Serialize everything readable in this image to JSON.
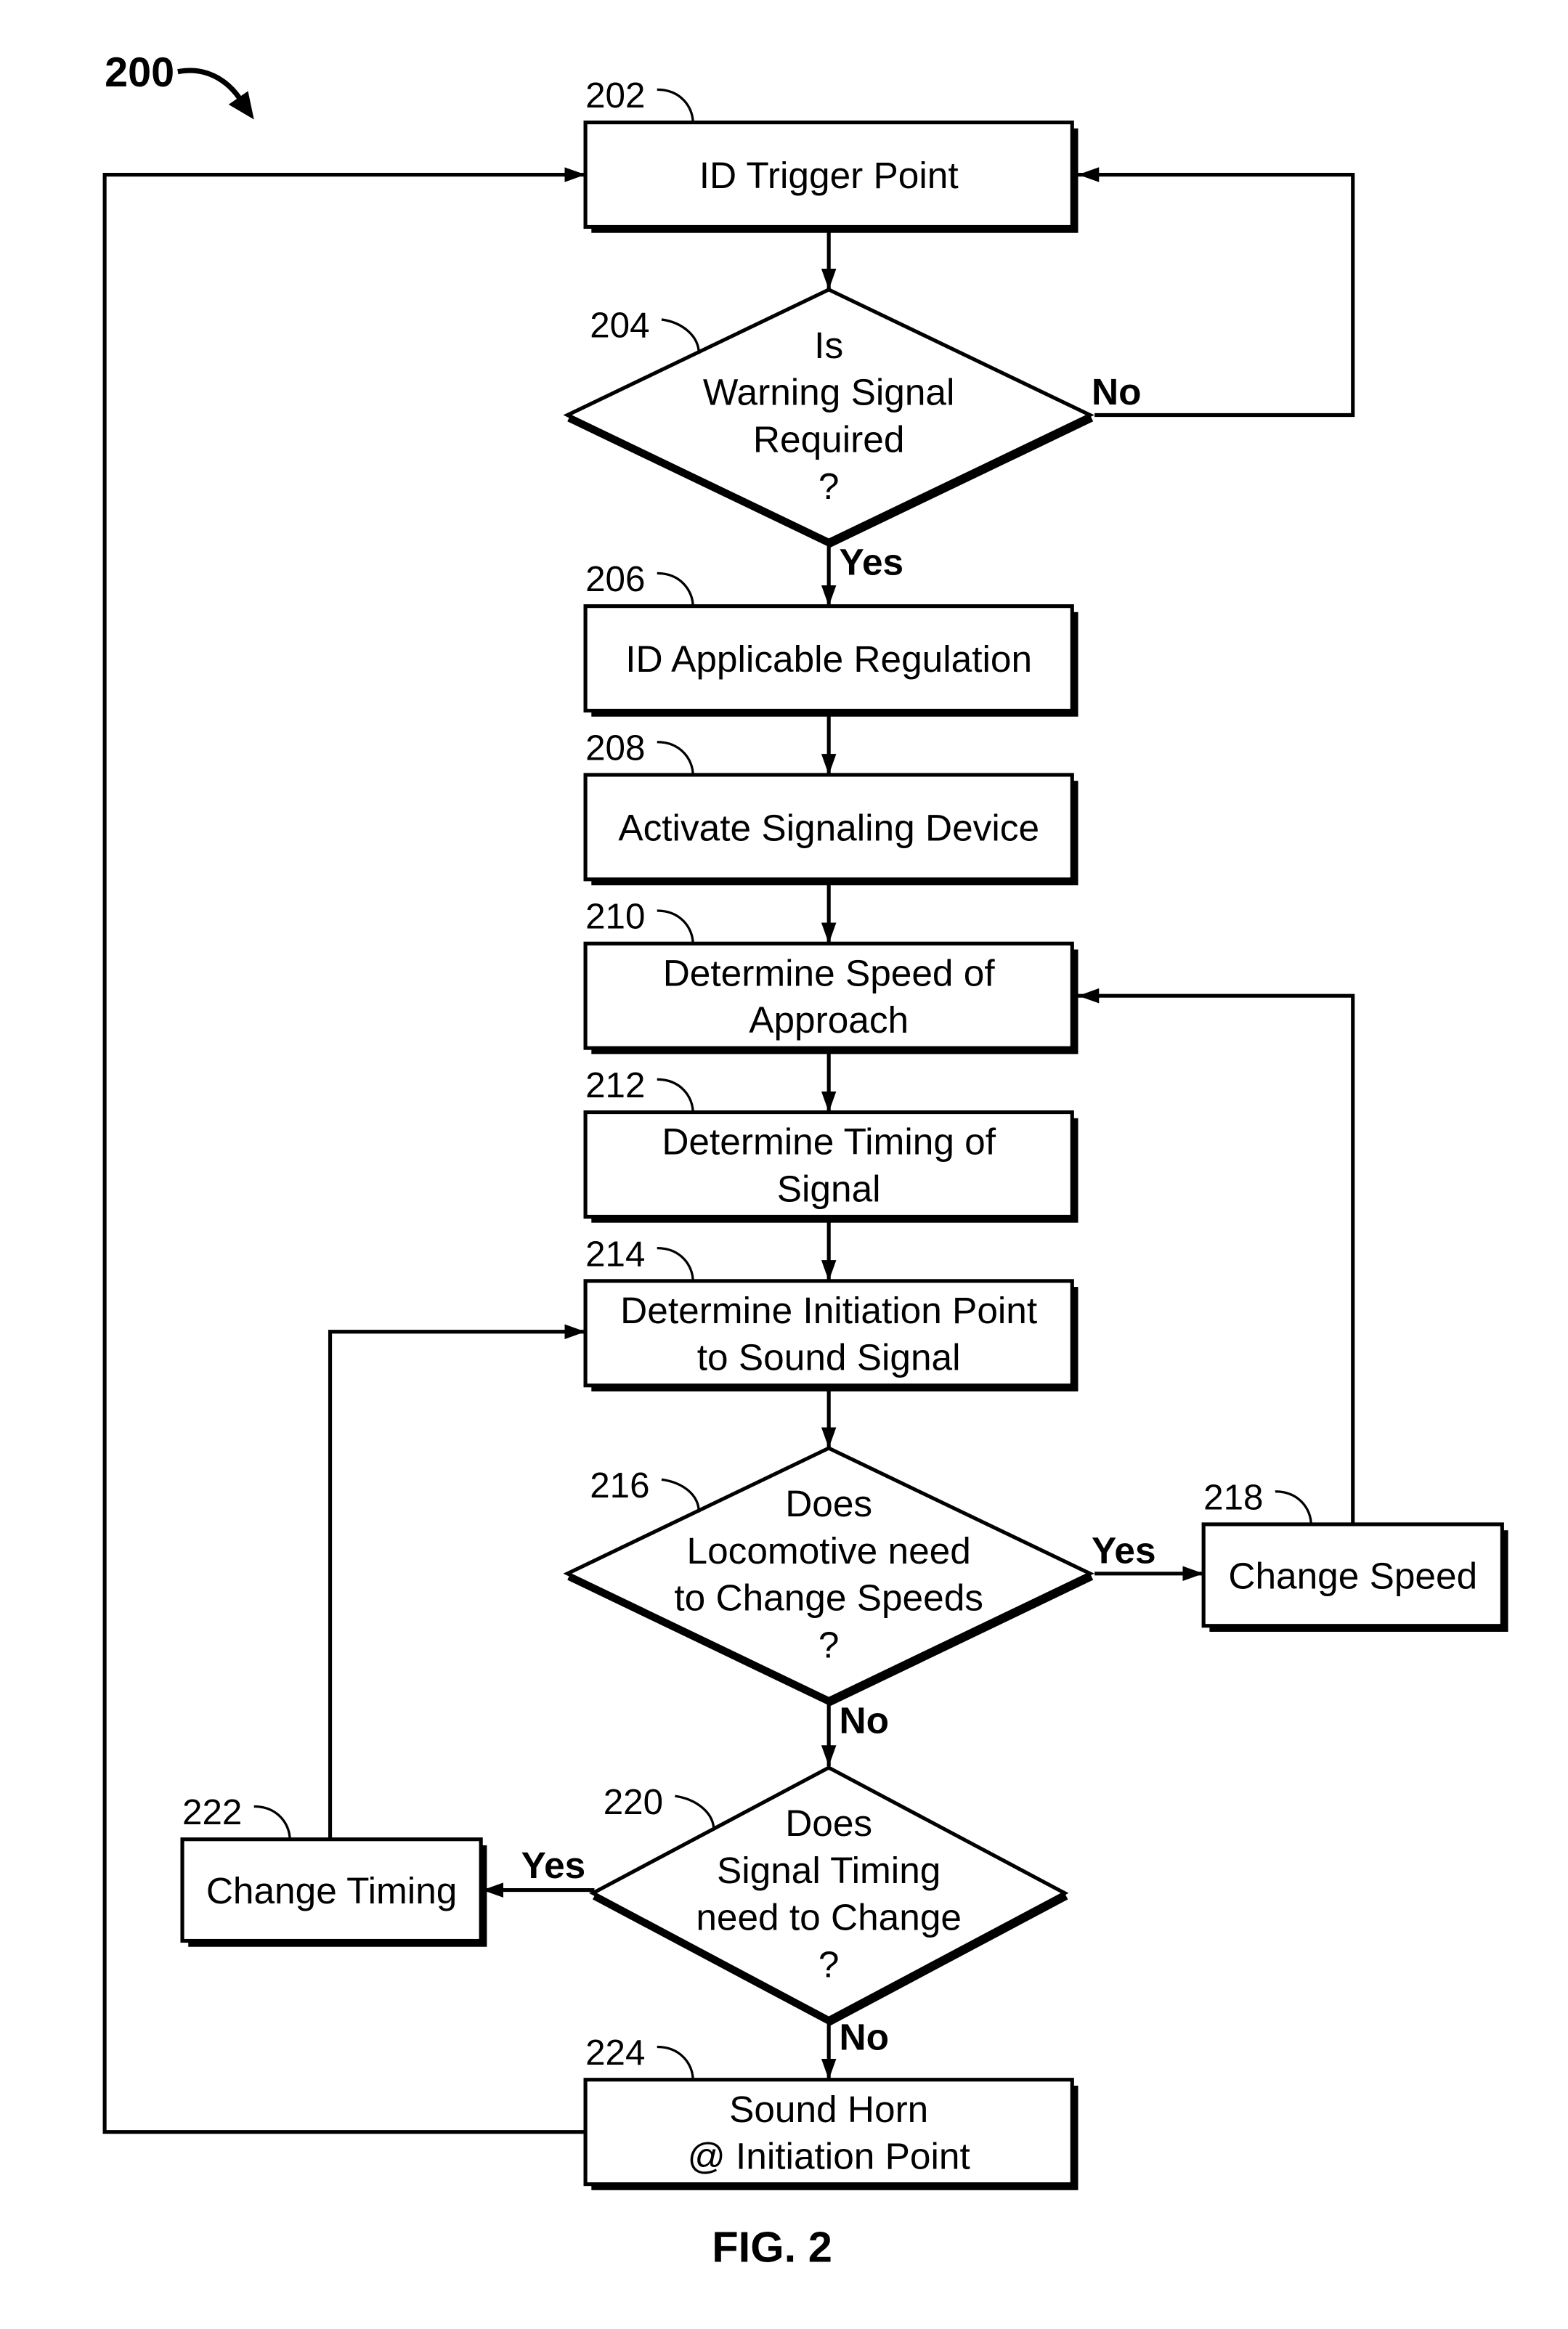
{
  "figure": {
    "number": "200",
    "caption": "FIG. 2"
  },
  "nodes": {
    "n202": {
      "ref": "202",
      "type": "process",
      "lines": [
        "ID Trigger Point"
      ]
    },
    "n204": {
      "ref": "204",
      "type": "decision",
      "lines": [
        "Is",
        "Warning Signal",
        "Required",
        "?"
      ]
    },
    "n206": {
      "ref": "206",
      "type": "process",
      "lines": [
        "ID Applicable Regulation"
      ]
    },
    "n208": {
      "ref": "208",
      "type": "process",
      "lines": [
        "Activate Signaling Device"
      ]
    },
    "n210": {
      "ref": "210",
      "type": "process",
      "lines": [
        "Determine Speed of",
        "Approach"
      ]
    },
    "n212": {
      "ref": "212",
      "type": "process",
      "lines": [
        "Determine Timing of",
        "Signal"
      ]
    },
    "n214": {
      "ref": "214",
      "type": "process",
      "lines": [
        "Determine Initiation Point",
        "to Sound Signal"
      ]
    },
    "n216": {
      "ref": "216",
      "type": "decision",
      "lines": [
        "Does",
        "Locomotive need",
        "to Change Speeds",
        "?"
      ]
    },
    "n218": {
      "ref": "218",
      "type": "process",
      "lines": [
        "Change Speed"
      ]
    },
    "n220": {
      "ref": "220",
      "type": "decision",
      "lines": [
        "Does",
        "Signal Timing",
        "need to Change",
        "?"
      ]
    },
    "n222": {
      "ref": "222",
      "type": "process",
      "lines": [
        "Change Timing"
      ]
    },
    "n224": {
      "ref": "224",
      "type": "process",
      "lines": [
        "Sound Horn",
        "@ Initiation Point"
      ]
    }
  },
  "edges": [
    {
      "from": "202",
      "to": "204",
      "label": ""
    },
    {
      "from": "204",
      "to": "202",
      "label": "No"
    },
    {
      "from": "204",
      "to": "206",
      "label": "Yes"
    },
    {
      "from": "206",
      "to": "208",
      "label": ""
    },
    {
      "from": "208",
      "to": "210",
      "label": ""
    },
    {
      "from": "210",
      "to": "212",
      "label": ""
    },
    {
      "from": "212",
      "to": "214",
      "label": ""
    },
    {
      "from": "214",
      "to": "216",
      "label": ""
    },
    {
      "from": "216",
      "to": "218",
      "label": "Yes"
    },
    {
      "from": "218",
      "to": "210",
      "label": ""
    },
    {
      "from": "216",
      "to": "220",
      "label": "No"
    },
    {
      "from": "220",
      "to": "222",
      "label": "Yes"
    },
    {
      "from": "222",
      "to": "214",
      "label": ""
    },
    {
      "from": "220",
      "to": "224",
      "label": "No"
    },
    {
      "from": "224",
      "to": "202",
      "label": ""
    }
  ],
  "labels": {
    "no_204": "No",
    "yes_204": "Yes",
    "yes_216": "Yes",
    "no_216": "No",
    "yes_220": "Yes",
    "no_220": "No"
  }
}
